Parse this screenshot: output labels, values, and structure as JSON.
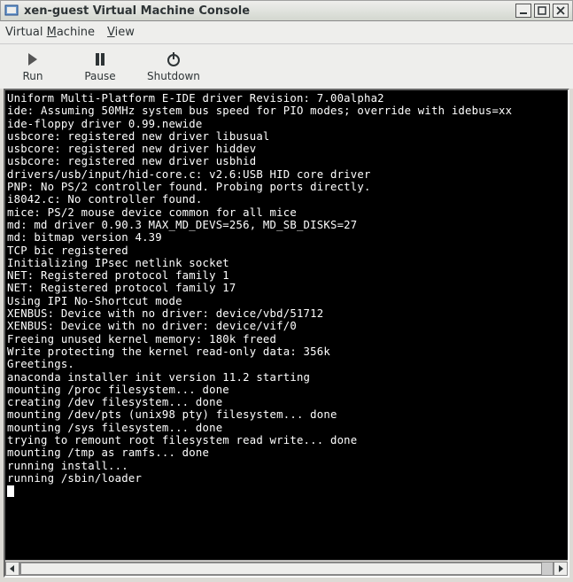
{
  "window": {
    "title": "xen-guest Virtual Machine Console"
  },
  "menubar": {
    "virtual_machine": "Virtual Machine",
    "view": "View"
  },
  "toolbar": {
    "run": "Run",
    "pause": "Pause",
    "shutdown": "Shutdown"
  },
  "console": {
    "lines": [
      "Uniform Multi-Platform E-IDE driver Revision: 7.00alpha2",
      "ide: Assuming 50MHz system bus speed for PIO modes; override with idebus=xx",
      "ide-floppy driver 0.99.newide",
      "usbcore: registered new driver libusual",
      "usbcore: registered new driver hiddev",
      "usbcore: registered new driver usbhid",
      "drivers/usb/input/hid-core.c: v2.6:USB HID core driver",
      "PNP: No PS/2 controller found. Probing ports directly.",
      "i8042.c: No controller found.",
      "mice: PS/2 mouse device common for all mice",
      "md: md driver 0.90.3 MAX_MD_DEVS=256, MD_SB_DISKS=27",
      "md: bitmap version 4.39",
      "TCP bic registered",
      "Initializing IPsec netlink socket",
      "NET: Registered protocol family 1",
      "NET: Registered protocol family 17",
      "Using IPI No-Shortcut mode",
      "XENBUS: Device with no driver: device/vbd/51712",
      "XENBUS: Device with no driver: device/vif/0",
      "Freeing unused kernel memory: 180k freed",
      "Write protecting the kernel read-only data: 356k",
      "Greetings.",
      "anaconda installer init version 11.2 starting",
      "mounting /proc filesystem... done",
      "creating /dev filesystem... done",
      "mounting /dev/pts (unix98 pty) filesystem... done",
      "mounting /sys filesystem... done",
      "trying to remount root filesystem read write... done",
      "mounting /tmp as ramfs... done",
      "running install...",
      "running /sbin/loader"
    ]
  }
}
